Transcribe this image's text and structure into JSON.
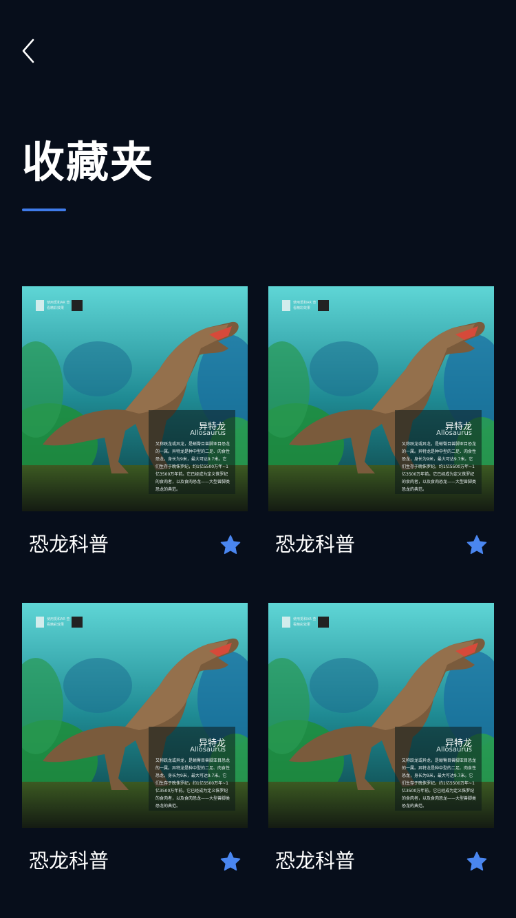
{
  "header": {
    "back_icon": "chevron-left-icon",
    "title": "收藏夹",
    "accent_color": "#3f7bea"
  },
  "favorites": [
    {
      "title": "恐龙科普",
      "starred": true,
      "poster": {
        "name_cn": "异特龙",
        "name_en": "Allosaurus",
        "tip": "使用觅和AR 查看精彩效果",
        "description": "又称跃龙或异龙，是蜥臀目兽脚亚目恐龙的一属。异特龙是种中型的二足、肉食性恐龙，身长为9米，最大可达9.7米。它们生存于晚侏罗纪，约1亿5500万年~1亿3500万年前。它已经成为定义侏罗纪的食肉者，以及食肉恐龙——大型兽脚类恐龙的典范。"
      }
    },
    {
      "title": "恐龙科普",
      "starred": true,
      "poster": {
        "name_cn": "异特龙",
        "name_en": "Allosaurus",
        "tip": "使用觅和AR 查看精彩效果",
        "description": "又称跃龙或异龙，是蜥臀目兽脚亚目恐龙的一属。异特龙是种中型的二足、肉食性恐龙，身长为9米，最大可达9.7米。它们生存于晚侏罗纪，约1亿5500万年~1亿3500万年前。它已经成为定义侏罗纪的食肉者，以及食肉恐龙——大型兽脚类恐龙的典范。"
      }
    },
    {
      "title": "恐龙科普",
      "starred": true,
      "poster": {
        "name_cn": "异特龙",
        "name_en": "Allosaurus",
        "tip": "使用觅和AR 查看精彩效果",
        "description": "又称跃龙或异龙，是蜥臀目兽脚亚目恐龙的一属。异特龙是种中型的二足、肉食性恐龙，身长为9米，最大可达9.7米。它们生存于晚侏罗纪，约1亿5500万年~1亿3500万年前。它已经成为定义侏罗纪的食肉者，以及食肉恐龙——大型兽脚类恐龙的典范。"
      }
    },
    {
      "title": "恐龙科普",
      "starred": true,
      "poster": {
        "name_cn": "异特龙",
        "name_en": "Allosaurus",
        "tip": "使用觅和AR 查看精彩效果",
        "description": "又称跃龙或异龙，是蜥臀目兽脚亚目恐龙的一属。异特龙是种中型的二足、肉食性恐龙，身长为9米，最大可达9.7米。它们生存于晚侏罗纪，约1亿5500万年~1亿3500万年前。它已经成为定义侏罗纪的食肉者，以及食肉恐龙——大型兽脚类恐龙的典范。"
      }
    }
  ],
  "icons": {
    "star": "star-icon",
    "star_color": "#4a86f0"
  }
}
